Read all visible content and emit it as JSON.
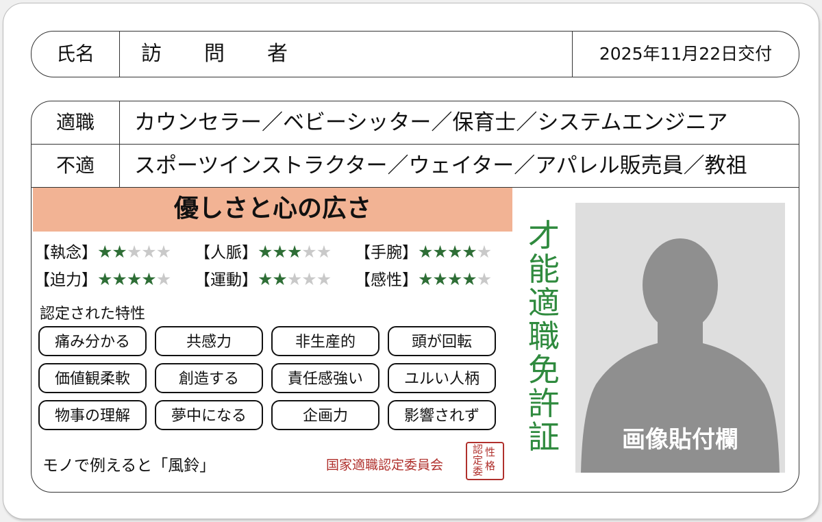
{
  "name_section": {
    "label": "氏名",
    "value": "訪問者",
    "issue_date": "2025年11月22日交付"
  },
  "suitable": {
    "label": "適職",
    "value": "カウンセラー／ベビーシッター／保育士／システムエンジニア"
  },
  "unsuitable": {
    "label": "不適",
    "value": "スポーツインストラクター／ウェイター／アパレル販売員／教祖"
  },
  "headline": "優しさと心の広さ",
  "ratings": [
    {
      "label": "【執念】",
      "stars": 2,
      "max": 5
    },
    {
      "label": "【人脈】",
      "stars": 3,
      "max": 5
    },
    {
      "label": "【手腕】",
      "stars": 4,
      "max": 5
    },
    {
      "label": "【迫力】",
      "stars": 4,
      "max": 5
    },
    {
      "label": "【運動】",
      "stars": 2,
      "max": 5
    },
    {
      "label": "【感性】",
      "stars": 4,
      "max": 5
    }
  ],
  "traits_title": "認定された特性",
  "traits": [
    "痛み分かる",
    "共感力",
    "非生産的",
    "頭が回転",
    "価値観柔軟",
    "創造する",
    "責任感強い",
    "ユルい人柄",
    "物事の理解",
    "夢中になる",
    "企画力",
    "影響されず"
  ],
  "analogy": "モノで例えると「風鈴」",
  "authority": "国家適職認定委員会",
  "seal_chars": [
    "性",
    "格",
    "認",
    "定",
    "委"
  ],
  "vertical_title": [
    "才",
    "能",
    "適",
    "職",
    "免",
    "許",
    "証"
  ],
  "photo": {
    "label": "画像貼付欄",
    "icon": "person-silhouette-icon"
  },
  "colors": {
    "headline_bg": "#f2b394",
    "star_on": "#2e6e36",
    "star_off": "#c9c9c9",
    "title_green": "#2f8a3e",
    "seal_red": "#b0302c"
  }
}
